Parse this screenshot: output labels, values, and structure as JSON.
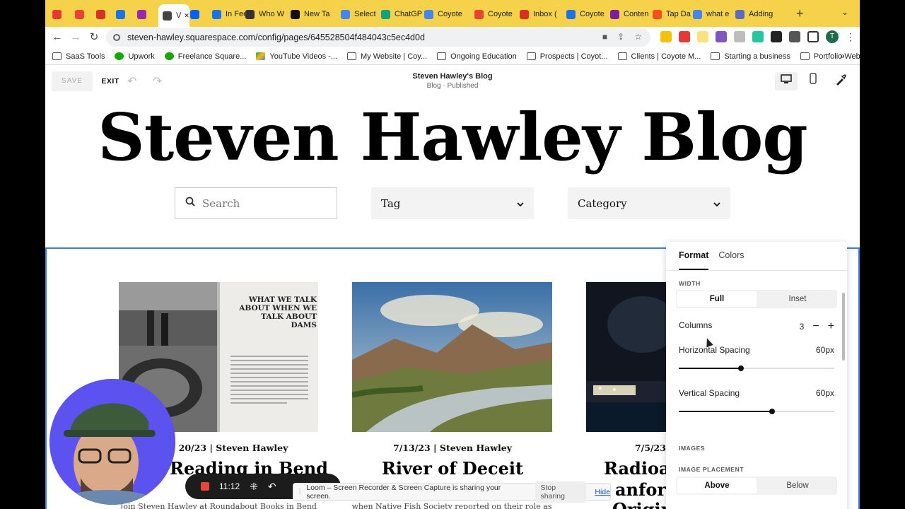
{
  "browser": {
    "tabs": [
      {
        "label": "",
        "color": "#e53935"
      },
      {
        "label": "",
        "color": "#ea4335"
      },
      {
        "label": "",
        "color": "#d93025"
      },
      {
        "label": "",
        "color": "#1a73e8"
      },
      {
        "label": "",
        "color": "#9c27b0"
      },
      {
        "label": "V",
        "color": "#444444",
        "active": true
      },
      {
        "label": "",
        "color": "#0061ff"
      },
      {
        "label": "In Feed",
        "color": "#1a73e8"
      },
      {
        "label": "Who W",
        "color": "#333333"
      },
      {
        "label": "New Ta",
        "color": "#111111"
      },
      {
        "label": "Select",
        "color": "#4285f4"
      },
      {
        "label": "ChatGP",
        "color": "#10a37f"
      },
      {
        "label": "Coyote",
        "color": "#4285f4"
      },
      {
        "label": "Coyote",
        "color": "#ea4335"
      },
      {
        "label": "Inbox (",
        "color": "#d93025"
      },
      {
        "label": "Coyote",
        "color": "#1a73e8"
      },
      {
        "label": "Conten",
        "color": "#7b1fa2"
      },
      {
        "label": "Tap Da",
        "color": "#f4511e"
      },
      {
        "label": "what e",
        "color": "#4285f4"
      },
      {
        "label": "Adding",
        "color": "#5c6bc0"
      }
    ],
    "new_tab_label": "+",
    "url": "steven-hawley.squarespace.com/config/pages/645528504f484043c5ec4d0d",
    "bookmarks": [
      {
        "label": "SaaS Tools",
        "icon": "folder-icon"
      },
      {
        "label": "Upwork",
        "icon": "upwork-icon"
      },
      {
        "label": "Freelance Square...",
        "icon": "upwork-icon"
      },
      {
        "label": "YouTube Videos -...",
        "icon": "drive-icon"
      },
      {
        "label": "My Website | Coy...",
        "icon": "folder-icon"
      },
      {
        "label": "Ongoing Education",
        "icon": "folder-icon"
      },
      {
        "label": "Prospects | Coyot...",
        "icon": "folder-icon"
      },
      {
        "label": "Clients | Coyote M...",
        "icon": "folder-icon"
      },
      {
        "label": "Starting a business",
        "icon": "folder-icon"
      },
      {
        "label": "Portfolio Website...",
        "icon": "folder-icon"
      }
    ],
    "bookmarks_more": "»",
    "profile_initial": "T"
  },
  "editor": {
    "save_label": "SAVE",
    "exit_label": "EXIT",
    "site_title": "Steven Hawley's Blog",
    "site_status": "Blog · Published"
  },
  "page": {
    "heading": "Steven Hawley Blog",
    "search_placeholder": "Search",
    "tag_label": "Tag",
    "category_label": "Category"
  },
  "posts": [
    {
      "date": "20/23",
      "author": "Steven Hawley",
      "title": "Reading in Bend",
      "excerpt": "Join Steven Hawley at Roundabout Books in Bend",
      "book_text": "WHAT WE TALK ABOUT WHEN WE TALK ABOUT DAMS"
    },
    {
      "date": "7/13/23",
      "author": "Steven Hawley",
      "title": "River of Deceit",
      "excerpt": "when Native Fish Society reported on their role as"
    },
    {
      "date": "7/5/23",
      "author": "",
      "title": "Radioac",
      "title_line2": "anford",
      "title_line3": "Origins",
      "excerpt": ""
    }
  ],
  "format_panel": {
    "tabs": [
      "Format",
      "Colors"
    ],
    "width_label": "WIDTH",
    "width_options": [
      "Full",
      "Inset"
    ],
    "width_selected": "Full",
    "columns_label": "Columns",
    "columns_value": "3",
    "h_spacing_label": "Horizontal Spacing",
    "h_spacing_value": "60px",
    "h_spacing_fraction": 0.4,
    "v_spacing_label": "Vertical Spacing",
    "v_spacing_value": "60px",
    "v_spacing_fraction": 0.6,
    "images_label": "IMAGES",
    "image_placement_label": "IMAGE PLACEMENT",
    "placement_options": [
      "Above",
      "Below"
    ],
    "placement_selected": "Above"
  },
  "recording": {
    "timer": "11:12",
    "share_message": "Loom – Screen Recorder & Screen Capture is sharing your screen.",
    "stop_sharing": "Stop sharing",
    "hide": "Hide"
  },
  "colors": {
    "tabstrip": "#f6d24a",
    "selection_outline": "#3e7ee0",
    "webcam_bg": "#5b52f0"
  }
}
